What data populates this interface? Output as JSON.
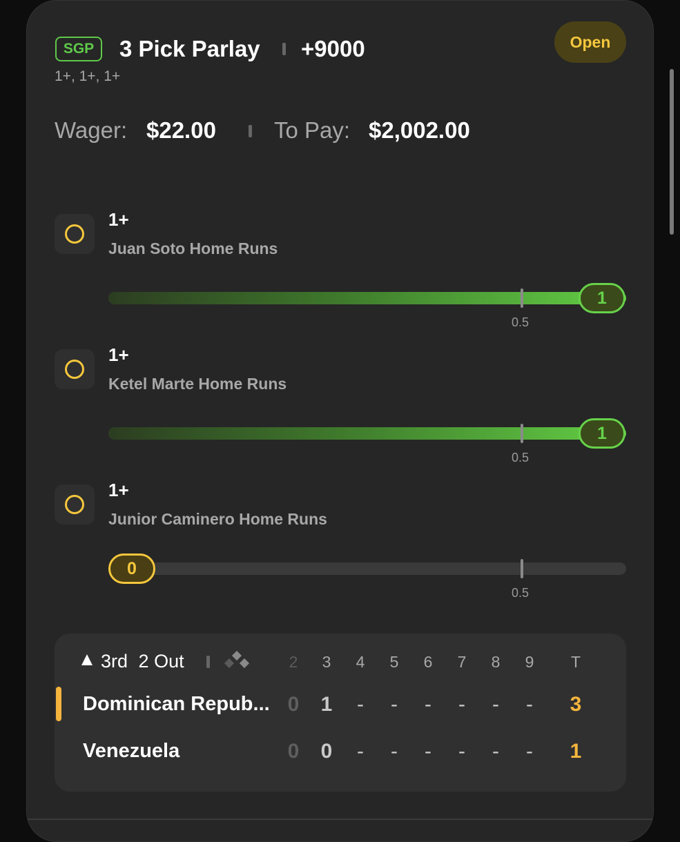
{
  "header": {
    "badge": "SGP",
    "title": "3 Pick Parlay",
    "odds": "+9000",
    "subtitle": "1+, 1+, 1+",
    "status": "Open"
  },
  "wager": {
    "wager_label": "Wager:",
    "wager_value": "$22.00",
    "pay_label": "To Pay:",
    "pay_value": "$2,002.00"
  },
  "legs": [
    {
      "line": "1+",
      "market": "Juan Soto Home Runs",
      "current": "1",
      "threshold": "0.5",
      "progress": 1.0,
      "state": "hit"
    },
    {
      "line": "1+",
      "market": "Ketel Marte Home Runs",
      "current": "1",
      "threshold": "0.5",
      "progress": 1.0,
      "state": "hit"
    },
    {
      "line": "1+",
      "market": "Junior Caminero Home Runs",
      "current": "0",
      "threshold": "0.5",
      "progress": 0.0,
      "state": "pending"
    }
  ],
  "scoreboard": {
    "inning": "3rd",
    "outs": "2 Out",
    "columns": [
      "2",
      "3",
      "4",
      "5",
      "6",
      "7",
      "8",
      "9",
      "T"
    ],
    "rows": [
      {
        "team": "Dominican Repub...",
        "cells": [
          "0",
          "1",
          "-",
          "-",
          "-",
          "-",
          "-",
          "-",
          "3"
        ],
        "batting": true
      },
      {
        "team": "Venezuela",
        "cells": [
          "0",
          "0",
          "-",
          "-",
          "-",
          "-",
          "-",
          "-",
          "1"
        ],
        "batting": false
      }
    ]
  },
  "colors": {
    "accent_green": "#67d24a",
    "accent_yellow": "#f5c73d",
    "score_total": "#f5b53d",
    "card_bg": "#262626"
  }
}
